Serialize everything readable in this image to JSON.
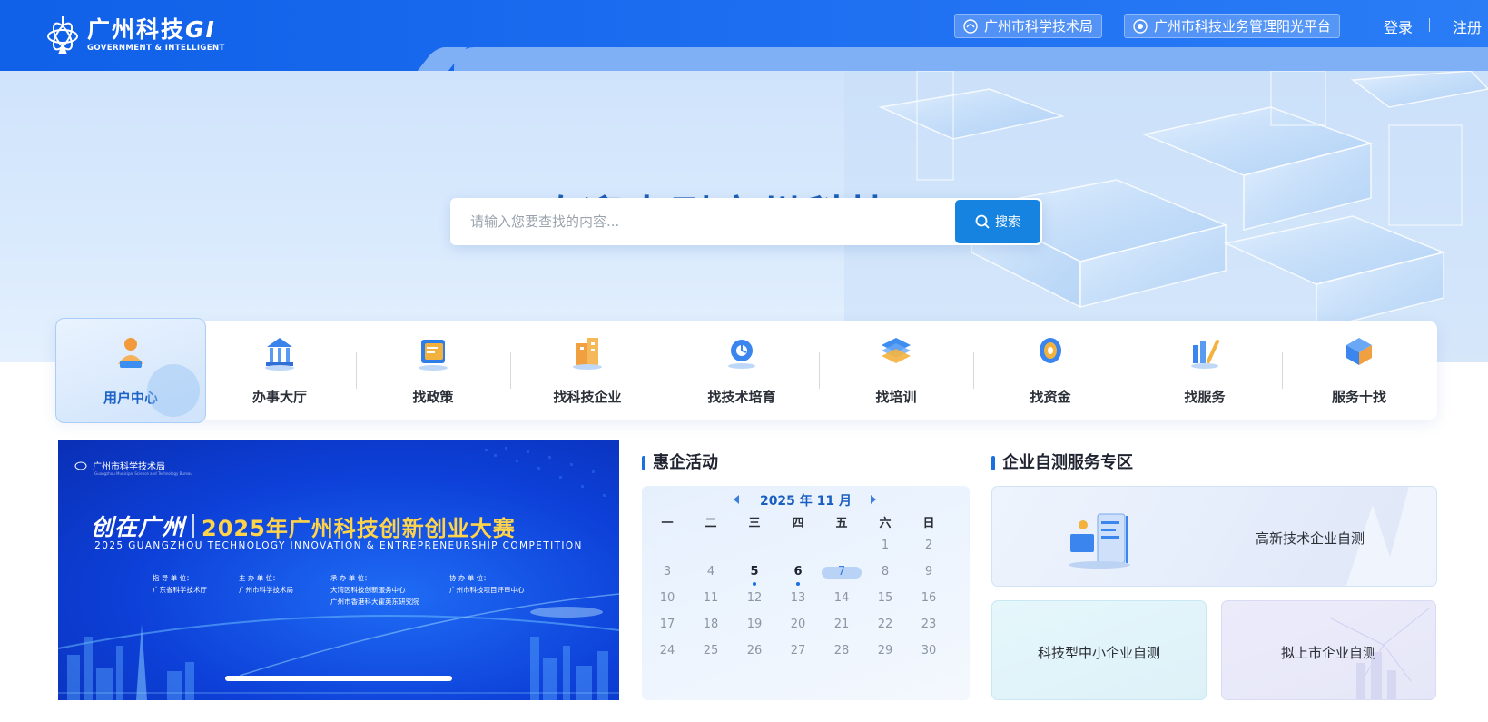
{
  "header": {
    "logo_cn": "广州科技",
    "logo_cn_mark": "GI",
    "logo_en": "GOVERNMENT & INTELLIGENT",
    "links": [
      {
        "label": "广州市科学技术局",
        "icon": "ministry-emblem-icon"
      },
      {
        "label": "广州市科技业务管理阳光平台",
        "icon": "platform-emblem-icon"
      }
    ],
    "login": "登录",
    "register": "注册"
  },
  "hero": {
    "title": "欢迎来到广州科技GI",
    "search_placeholder": "请输入您要查找的内容...",
    "search_value": "",
    "search_button": "搜索"
  },
  "nav": {
    "items": [
      {
        "label": "用户中心",
        "icon": "user-center-icon",
        "active": true
      },
      {
        "label": "办事大厅",
        "icon": "service-hall-icon"
      },
      {
        "label": "找政策",
        "icon": "policy-icon"
      },
      {
        "label": "找科技企业",
        "icon": "tech-enterprise-icon"
      },
      {
        "label": "找技术培育",
        "icon": "tech-incubation-icon"
      },
      {
        "label": "找培训",
        "icon": "training-icon"
      },
      {
        "label": "找资金",
        "icon": "funding-icon"
      },
      {
        "label": "找服务",
        "icon": "find-service-icon"
      },
      {
        "label": "服务十找",
        "icon": "service-ten-icon"
      }
    ]
  },
  "banner": {
    "org": "广州市科学技术局",
    "org_en": "Guangzhou Municipal Science and Technology Bureau",
    "slogan": "创在广州",
    "title": "2025年广州科技创新创业大赛",
    "title_en": "2025 GUANGZHOU TECHNOLOGY INNOVATION & ENTREPRENEURSHIP COMPETITION",
    "orgs": [
      {
        "label": "指 导 单 位：",
        "lines": [
          "广东省科学技术厅"
        ]
      },
      {
        "label": "主 办 单 位：",
        "lines": [
          "广州市科学技术局"
        ]
      },
      {
        "label": "承 办 单 位：",
        "lines": [
          "大湾区科技创新服务中心",
          "广州市香港科大霍英东研究院"
        ]
      },
      {
        "label": "协 办 单 位：",
        "lines": [
          "广州市科技项目评审中心"
        ]
      }
    ],
    "progress": 1.0
  },
  "activities": {
    "title": "惠企活动",
    "calendar": {
      "year": "2025",
      "year_unit": "年",
      "month": "11",
      "month_unit": "月",
      "weekdays": [
        "一",
        "二",
        "三",
        "四",
        "五",
        "六",
        "日"
      ],
      "weeks": [
        [
          "",
          "",
          "",
          "",
          "",
          "1",
          "2"
        ],
        [
          "3",
          "4",
          "5",
          "6",
          "7",
          "8",
          "9"
        ],
        [
          "10",
          "11",
          "12",
          "13",
          "14",
          "15",
          "16"
        ],
        [
          "17",
          "18",
          "19",
          "20",
          "21",
          "22",
          "23"
        ],
        [
          "24",
          "25",
          "26",
          "27",
          "28",
          "29",
          "30"
        ]
      ],
      "event_days": [
        "5",
        "6"
      ],
      "today": "7"
    }
  },
  "services": {
    "title": "企业自测服务专区",
    "cards": [
      {
        "label": "高新技术企业自测"
      },
      {
        "label": "科技型中小企业自测"
      },
      {
        "label": "拟上市企业自测"
      }
    ]
  },
  "colors": {
    "primary": "#1f6ff2",
    "accent": "#1583df",
    "title": "#1b5db5",
    "banner_gold": "#ffd44a"
  }
}
